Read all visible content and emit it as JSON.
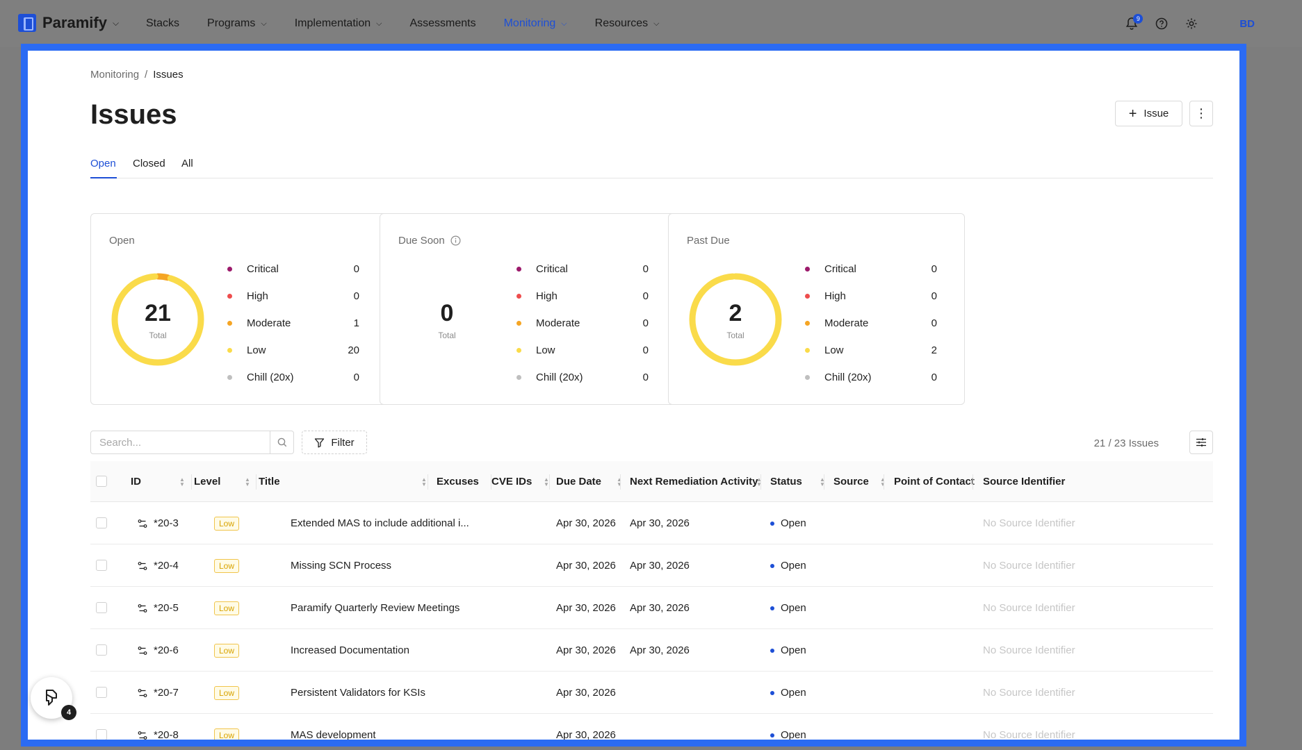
{
  "brand": {
    "name": "Paramify"
  },
  "nav": {
    "items": [
      {
        "label": "Stacks",
        "dropdown": false,
        "active": false
      },
      {
        "label": "Programs",
        "dropdown": true,
        "active": false
      },
      {
        "label": "Implementation",
        "dropdown": true,
        "active": false
      },
      {
        "label": "Assessments",
        "dropdown": false,
        "active": false
      },
      {
        "label": "Monitoring",
        "dropdown": true,
        "active": true
      },
      {
        "label": "Resources",
        "dropdown": true,
        "active": false
      }
    ],
    "notification_count": "9",
    "avatar_initials": "BD"
  },
  "breadcrumb": {
    "parent": "Monitoring",
    "separator": "/",
    "current": "Issues"
  },
  "page": {
    "title": "Issues",
    "add_button_label": "Issue"
  },
  "tabs": [
    {
      "label": "Open",
      "active": true
    },
    {
      "label": "Closed",
      "active": false
    },
    {
      "label": "All",
      "active": false
    }
  ],
  "summary_cards": [
    {
      "title": "Open",
      "total": "21",
      "total_label": "Total",
      "has_info": false,
      "levels": [
        {
          "label": "Critical",
          "value": "0",
          "color": "#9c1a6b"
        },
        {
          "label": "High",
          "value": "0",
          "color": "#ee4d4d"
        },
        {
          "label": "Moderate",
          "value": "1",
          "color": "#f5a524"
        },
        {
          "label": "Low",
          "value": "20",
          "color": "#fadb4a"
        },
        {
          "label": "Chill (20x)",
          "value": "0",
          "color": "#bfbfbf"
        }
      ]
    },
    {
      "title": "Due Soon",
      "total": "0",
      "total_label": "Total",
      "has_info": true,
      "levels": [
        {
          "label": "Critical",
          "value": "0",
          "color": "#9c1a6b"
        },
        {
          "label": "High",
          "value": "0",
          "color": "#ee4d4d"
        },
        {
          "label": "Moderate",
          "value": "0",
          "color": "#f5a524"
        },
        {
          "label": "Low",
          "value": "0",
          "color": "#fadb4a"
        },
        {
          "label": "Chill (20x)",
          "value": "0",
          "color": "#bfbfbf"
        }
      ]
    },
    {
      "title": "Past Due",
      "total": "2",
      "total_label": "Total",
      "has_info": false,
      "levels": [
        {
          "label": "Critical",
          "value": "0",
          "color": "#9c1a6b"
        },
        {
          "label": "High",
          "value": "0",
          "color": "#ee4d4d"
        },
        {
          "label": "Moderate",
          "value": "0",
          "color": "#f5a524"
        },
        {
          "label": "Low",
          "value": "2",
          "color": "#fadb4a"
        },
        {
          "label": "Chill (20x)",
          "value": "0",
          "color": "#bfbfbf"
        }
      ]
    }
  ],
  "toolbar": {
    "search_placeholder": "Search...",
    "filter_label": "Filter",
    "count_text": "21 / 23 Issues"
  },
  "table": {
    "columns": [
      "ID",
      "Level",
      "Title",
      "Excuses",
      "CVE IDs",
      "Due Date",
      "Next Remediation Activity",
      "Status",
      "Source",
      "Point of Contact",
      "Source Identifier"
    ],
    "rows": [
      {
        "id": "*20-3",
        "level": "Low",
        "title": "Extended MAS to include additional i...",
        "excuses": "",
        "cve": "",
        "due": "Apr 30, 2026",
        "next": "Apr 30, 2026",
        "status": "Open",
        "source": "",
        "poc": "",
        "source_id": "No Source Identifier"
      },
      {
        "id": "*20-4",
        "level": "Low",
        "title": "Missing SCN Process",
        "excuses": "",
        "cve": "",
        "due": "Apr 30, 2026",
        "next": "Apr 30, 2026",
        "status": "Open",
        "source": "",
        "poc": "",
        "source_id": "No Source Identifier"
      },
      {
        "id": "*20-5",
        "level": "Low",
        "title": "Paramify Quarterly Review Meetings",
        "excuses": "",
        "cve": "",
        "due": "Apr 30, 2026",
        "next": "Apr 30, 2026",
        "status": "Open",
        "source": "",
        "poc": "",
        "source_id": "No Source Identifier"
      },
      {
        "id": "*20-6",
        "level": "Low",
        "title": "Increased Documentation",
        "excuses": "",
        "cve": "",
        "due": "Apr 30, 2026",
        "next": "Apr 30, 2026",
        "status": "Open",
        "source": "",
        "poc": "",
        "source_id": "No Source Identifier"
      },
      {
        "id": "*20-7",
        "level": "Low",
        "title": "Persistent Validators for KSIs",
        "excuses": "",
        "cve": "",
        "due": "Apr 30, 2026",
        "next": "",
        "status": "Open",
        "source": "",
        "poc": "",
        "source_id": "No Source Identifier"
      },
      {
        "id": "*20-8",
        "level": "Low",
        "title": "MAS development",
        "excuses": "",
        "cve": "",
        "due": "Apr 30, 2026",
        "next": "",
        "status": "Open",
        "source": "",
        "poc": "",
        "source_id": "No Source Identifier"
      }
    ]
  },
  "assistant": {
    "badge_count": "4"
  }
}
